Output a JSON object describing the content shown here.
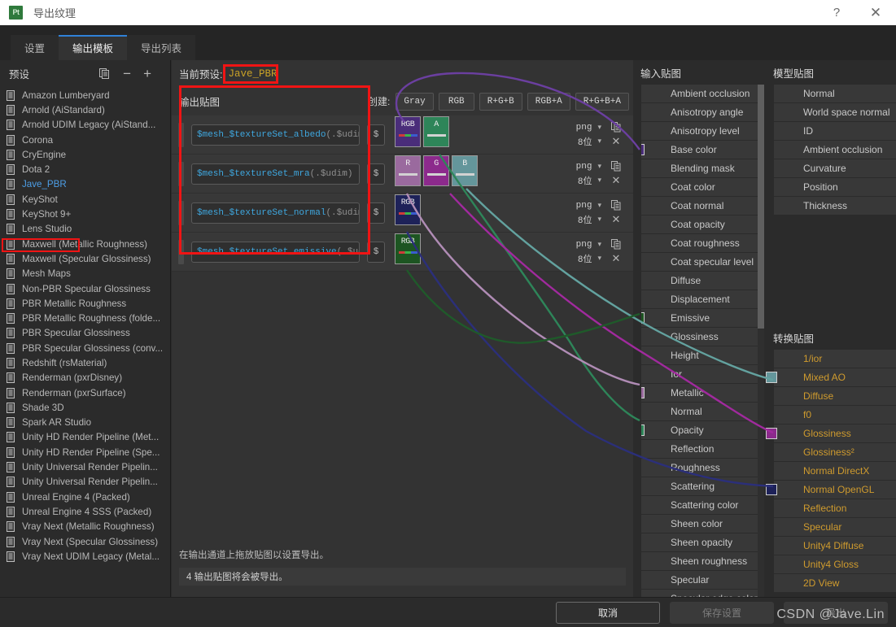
{
  "window": {
    "app_badge": "Pt",
    "title": "导出纹理",
    "help_label": "?",
    "close_label": "✕"
  },
  "tabs": [
    {
      "label": "设置",
      "active": false
    },
    {
      "label": "输出模板",
      "active": true
    },
    {
      "label": "导出列表",
      "active": false
    }
  ],
  "presets": {
    "title": "预设",
    "copy_icon": "duplicate-icon",
    "remove_label": "−",
    "add_label": "+",
    "selected": "Jave_PBR",
    "items": [
      "Amazon Lumberyard",
      "Arnold (AiStandard)",
      "Arnold UDIM Legacy (AiStand...",
      "Corona",
      "CryEngine",
      "Dota 2",
      "Jave_PBR",
      "KeyShot",
      "KeyShot 9+",
      "Lens Studio",
      "Maxwell (Metallic Roughness)",
      "Maxwell (Specular Glossiness)",
      "Mesh Maps",
      "Non-PBR Specular Glossiness",
      "PBR Metallic Roughness",
      "PBR Metallic Roughness (folde...",
      "PBR Specular Glossiness",
      "PBR Specular Glossiness (conv...",
      "Redshift (rsMaterial)",
      "Renderman (pxrDisney)",
      "Renderman (pxrSurface)",
      "Shade 3D",
      "Spark AR Studio",
      "Unity HD Render Pipeline (Met...",
      "Unity HD Render Pipeline (Spe...",
      "Unity Universal Render Pipelin...",
      "Unity Universal Render Pipelin...",
      "Unreal Engine 4 (Packed)",
      "Unreal Engine 4 SSS (Packed)",
      "Vray Next (Metallic Roughness)",
      "Vray Next (Specular Glossiness)",
      "Vray Next UDIM Legacy (Metal..."
    ]
  },
  "current_preset": {
    "label": "当前预设:",
    "value": "Jave_PBR"
  },
  "output_maps": {
    "title": "输出贴图",
    "create_label": "创建:",
    "channel_buttons": [
      "Gray",
      "RGB",
      "R+G+B",
      "RGB+A",
      "R+G+B+A"
    ],
    "rows": [
      {
        "name_prefix": "$mesh_$textureSet_albedo",
        "name_suffix": "(.$udim)",
        "dollar": "$",
        "format": "png",
        "depth": "8位",
        "chips": [
          {
            "text": "RGB",
            "bg": "#4a2d7a",
            "bar": "rgb"
          },
          {
            "text": "A",
            "bg": "#2e8559",
            "bar": "plain"
          }
        ]
      },
      {
        "name_prefix": "$mesh_$textureSet_mra",
        "name_suffix": "(.$udim)",
        "dollar": "$",
        "format": "png",
        "depth": "8位",
        "chips": [
          {
            "text": "R",
            "bg": "#9a6a9e",
            "bar": "plain"
          },
          {
            "text": "G",
            "bg": "#8c2a8c",
            "bar": "plain"
          },
          {
            "text": "B",
            "bg": "#64969b",
            "bar": "plain"
          }
        ]
      },
      {
        "name_prefix": "$mesh_$textureSet_normal",
        "name_suffix": "(.$udim)",
        "dollar": "$",
        "format": "png",
        "depth": "8位",
        "chips": [
          {
            "text": "RGB",
            "bg": "#1e2259",
            "bar": "rgb"
          }
        ]
      },
      {
        "name_prefix": "$mesh_$textureSet_emissive",
        "name_suffix": "(.$udim)",
        "dollar": "$",
        "format": "png",
        "depth": "8位",
        "chips": [
          {
            "text": "RGB",
            "bg": "#1d5522",
            "bar": "rgb"
          }
        ]
      }
    ],
    "hint": "在输出通道上拖放贴图以设置导出。",
    "count_text": "4 输出贴图将会被导出。"
  },
  "input_maps": {
    "title": "输入贴图",
    "items": [
      {
        "label": "Ambient occlusion",
        "swatch": null
      },
      {
        "label": "Anisotropy angle",
        "swatch": null
      },
      {
        "label": "Anisotropy level",
        "swatch": null
      },
      {
        "label": "Base color",
        "swatch": "#4a2d7a"
      },
      {
        "label": "Blending mask",
        "swatch": null
      },
      {
        "label": "Coat color",
        "swatch": null
      },
      {
        "label": "Coat normal",
        "swatch": null
      },
      {
        "label": "Coat opacity",
        "swatch": null
      },
      {
        "label": "Coat roughness",
        "swatch": null
      },
      {
        "label": "Coat specular level",
        "swatch": null
      },
      {
        "label": "Diffuse",
        "swatch": null
      },
      {
        "label": "Displacement",
        "swatch": null
      },
      {
        "label": "Emissive",
        "swatch": "#1d5522"
      },
      {
        "label": "Glossiness",
        "swatch": null
      },
      {
        "label": "Height",
        "swatch": null
      },
      {
        "label": "Ior",
        "swatch": null
      },
      {
        "label": "Metallic",
        "swatch": "#9a6a9e"
      },
      {
        "label": "Normal",
        "swatch": null
      },
      {
        "label": "Opacity",
        "swatch": "#2e8559"
      },
      {
        "label": "Reflection",
        "swatch": null
      },
      {
        "label": "Roughness",
        "swatch": null
      },
      {
        "label": "Scattering",
        "swatch": null
      },
      {
        "label": "Scattering color",
        "swatch": null
      },
      {
        "label": "Sheen color",
        "swatch": null
      },
      {
        "label": "Sheen opacity",
        "swatch": null
      },
      {
        "label": "Sheen roughness",
        "swatch": null
      },
      {
        "label": "Specular",
        "swatch": null
      },
      {
        "label": "Specular edge color",
        "swatch": null
      }
    ]
  },
  "model_maps": {
    "title": "模型贴图",
    "items": [
      {
        "label": "Normal",
        "swatch": null
      },
      {
        "label": "World space normal",
        "swatch": null
      },
      {
        "label": "ID",
        "swatch": null
      },
      {
        "label": "Ambient occlusion",
        "swatch": null
      },
      {
        "label": "Curvature",
        "swatch": null
      },
      {
        "label": "Position",
        "swatch": null
      },
      {
        "label": "Thickness",
        "swatch": null
      }
    ]
  },
  "conversion_maps": {
    "title": "转换贴图",
    "items": [
      {
        "label": "1/ior",
        "swatch": null
      },
      {
        "label": "Mixed AO",
        "swatch": "#64969b"
      },
      {
        "label": "Diffuse",
        "swatch": null
      },
      {
        "label": "f0",
        "swatch": null
      },
      {
        "label": "Glossiness",
        "swatch": "#8c2a8c"
      },
      {
        "label": "Glossiness²",
        "swatch": null
      },
      {
        "label": "Normal DirectX",
        "swatch": null
      },
      {
        "label": "Normal OpenGL",
        "swatch": "#1e2259"
      },
      {
        "label": "Reflection",
        "swatch": null
      },
      {
        "label": "Specular",
        "swatch": null
      },
      {
        "label": "Unity4 Diffuse",
        "swatch": null
      },
      {
        "label": "Unity4 Gloss",
        "swatch": null
      },
      {
        "label": "2D View",
        "swatch": null
      }
    ]
  },
  "footer": {
    "cancel": "取消",
    "save": "保存设置",
    "export": "导出"
  },
  "watermark": "CSDN @Jave.Lin",
  "wires": [
    {
      "name": "base-color-wire",
      "color": "#6b3fa0"
    },
    {
      "name": "opacity-wire",
      "color": "#2e8559"
    },
    {
      "name": "metallic-wire",
      "color": "#b08cb5"
    },
    {
      "name": "glossiness-wire",
      "color": "#a12a9e"
    },
    {
      "name": "mixed-ao-wire",
      "color": "#63a29f"
    },
    {
      "name": "normal-opengl-wire",
      "color": "#2b2f7a"
    },
    {
      "name": "emissive-wire",
      "color": "#1f5a2a"
    }
  ]
}
